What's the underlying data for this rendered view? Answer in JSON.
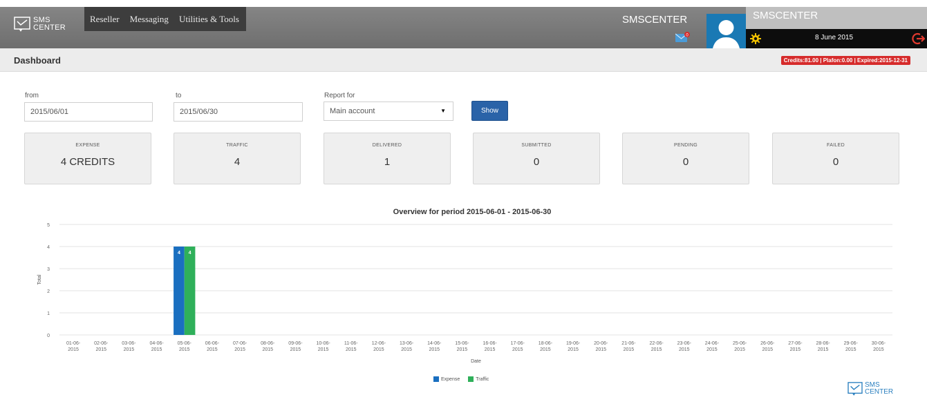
{
  "header": {
    "logo_text_line1": "SMS",
    "logo_text_line2": "CENTER",
    "menu": [
      "Reseller",
      "Messaging",
      "Utilities & Tools"
    ],
    "brand_name": "SMSCENTER",
    "user_name": "SMSCENTER",
    "date": "8 June 2015",
    "mail_badge": "0"
  },
  "page": {
    "title": "Dashboard",
    "credits_badge": "Credits:81.00 | Plafon:0.00 | Expired:2015-12-31"
  },
  "filters": {
    "from_label": "from",
    "from_value": "2015/06/01",
    "to_label": "to",
    "to_value": "2015/06/30",
    "report_label": "Report for",
    "report_value": "Main account",
    "show_button": "Show"
  },
  "stats": [
    {
      "label": "EXPENSE",
      "value": "4 CREDITS"
    },
    {
      "label": "TRAFFIC",
      "value": "4"
    },
    {
      "label": "DELIVERED",
      "value": "1"
    },
    {
      "label": "SUBMITTED",
      "value": "0"
    },
    {
      "label": "PENDING",
      "value": "0"
    },
    {
      "label": "FAILED",
      "value": "0"
    }
  ],
  "footer": {
    "logo_text_line1": "SMS",
    "logo_text_line2": "CENTER"
  },
  "colors": {
    "expense": "#1a6fc0",
    "traffic": "#2fb05a",
    "accent": "#2a63a8",
    "badge": "#d62b2b"
  },
  "chart_data": {
    "type": "bar",
    "title": "Overview for period 2015-06-01 - 2015-06-30",
    "xlabel": "Date",
    "ylabel": "Total",
    "ylim": [
      0,
      5
    ],
    "yticks": [
      0,
      1,
      2,
      3,
      4,
      5
    ],
    "grid": true,
    "legend": "bottom-center",
    "categories": [
      "01-06-2015",
      "02-06-2015",
      "03-06-2015",
      "04-06-2015",
      "05-06-2015",
      "06-06-2015",
      "07-06-2015",
      "08-06-2015",
      "09-06-2015",
      "10-06-2015",
      "11-06-2015",
      "12-06-2015",
      "13-06-2015",
      "14-06-2015",
      "15-06-2015",
      "16-06-2015",
      "17-06-2015",
      "18-06-2015",
      "19-06-2015",
      "20-06-2015",
      "21-06-2015",
      "22-06-2015",
      "23-06-2015",
      "24-06-2015",
      "25-06-2015",
      "26-06-2015",
      "27-06-2015",
      "28-06-2015",
      "29-06-2015",
      "30-06-2015"
    ],
    "series": [
      {
        "name": "Expense",
        "values": [
          0,
          0,
          0,
          0,
          4,
          0,
          0,
          0,
          0,
          0,
          0,
          0,
          0,
          0,
          0,
          0,
          0,
          0,
          0,
          0,
          0,
          0,
          0,
          0,
          0,
          0,
          0,
          0,
          0,
          0
        ]
      },
      {
        "name": "Traffic",
        "values": [
          0,
          0,
          0,
          0,
          4,
          0,
          0,
          0,
          0,
          0,
          0,
          0,
          0,
          0,
          0,
          0,
          0,
          0,
          0,
          0,
          0,
          0,
          0,
          0,
          0,
          0,
          0,
          0,
          0,
          0
        ]
      }
    ]
  }
}
